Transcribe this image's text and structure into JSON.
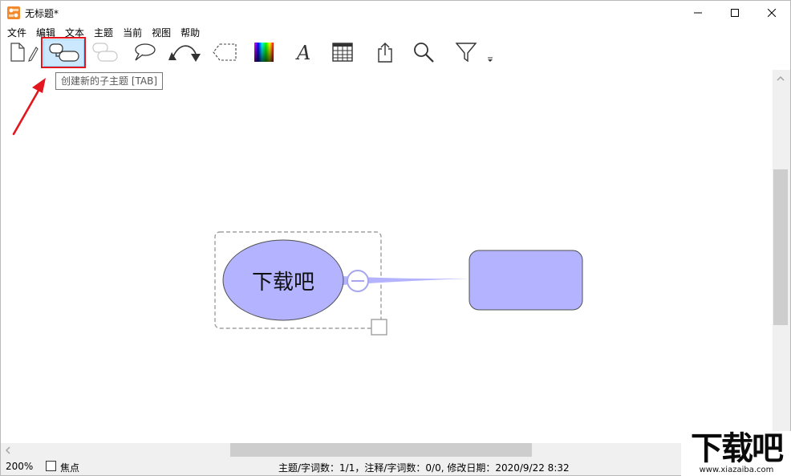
{
  "window": {
    "title": "无标题*",
    "minimize_icon": "minimize-icon",
    "maximize_icon": "maximize-icon",
    "close_icon": "close-icon"
  },
  "menu": {
    "items": [
      "文件",
      "编辑",
      "文本",
      "主题",
      "当前",
      "视图",
      "帮助"
    ]
  },
  "toolbar": {
    "tools": [
      {
        "name": "new-document",
        "icon": "new-document-icon"
      },
      {
        "name": "edit",
        "icon": "pencil-icon"
      },
      {
        "name": "create-subtopic",
        "icon": "subtopic-icon",
        "active": true
      },
      {
        "name": "create-sibling-topic",
        "icon": "sibling-topic-icon",
        "disabled": true
      },
      {
        "name": "callout",
        "icon": "callout-icon"
      },
      {
        "name": "relationship",
        "icon": "relationship-arrow-icon"
      },
      {
        "name": "boundary",
        "icon": "boundary-icon"
      },
      {
        "name": "color",
        "icon": "color-palette-icon"
      },
      {
        "name": "font",
        "icon": "font-icon"
      },
      {
        "name": "table",
        "icon": "table-icon"
      },
      {
        "name": "export",
        "icon": "export-icon"
      },
      {
        "name": "search",
        "icon": "search-icon"
      },
      {
        "name": "filter",
        "icon": "filter-icon"
      },
      {
        "name": "more",
        "icon": "overflow-icon"
      }
    ]
  },
  "tooltip": {
    "text": "创建新的子主题 [TAB]"
  },
  "mindmap": {
    "central_topic": "下载吧",
    "central_color": "#b3b3ff",
    "child_color": "#b3b3ff",
    "collapse_icon": "collapse-minus-icon"
  },
  "annotation": {
    "highlight_color": "#e3161e",
    "arrow_icon": "red-arrow-icon"
  },
  "status": {
    "zoom": "200%",
    "focus_label": "焦点",
    "focus_checked": false,
    "info": "主题/字词数：1/1，注释/字词数：0/0, 修改日期：2020/9/22 8:32"
  },
  "watermark": {
    "big": "下载吧",
    "small": "www.xiazaiba.com"
  }
}
